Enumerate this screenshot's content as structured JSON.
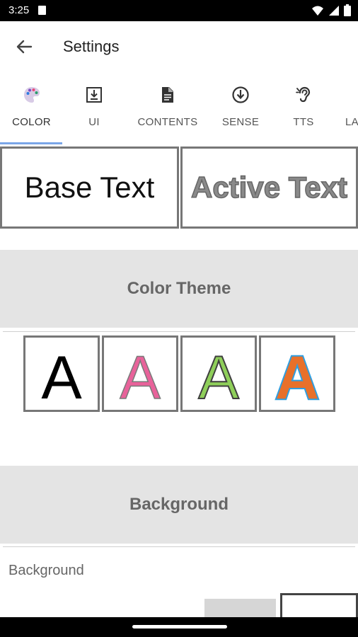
{
  "status": {
    "time": "3:25"
  },
  "header": {
    "title": "Settings"
  },
  "tabs": [
    {
      "label": "COLOR",
      "icon": "palette-icon"
    },
    {
      "label": "UI",
      "icon": "download-box-icon"
    },
    {
      "label": "CONTENTS",
      "icon": "document-icon"
    },
    {
      "label": "SENSE",
      "icon": "arrow-circle-icon"
    },
    {
      "label": "TTS",
      "icon": "ear-icon"
    },
    {
      "label": "LA",
      "icon": ""
    }
  ],
  "preview": {
    "base": "Base Text",
    "active": "Active Text"
  },
  "sections": {
    "color_theme": "Color Theme",
    "background": "Background"
  },
  "color_themes": [
    {
      "letter": "A",
      "fill": "#000000",
      "outline": ""
    },
    {
      "letter": "A",
      "fill": "#e8629a",
      "outline": "#7a7a7a"
    },
    {
      "letter": "A",
      "fill": "#8fcf5a",
      "outline": "#3f3f3f"
    },
    {
      "letter": "A",
      "fill": "#e8702a",
      "outline": "#2f9ee0"
    }
  ],
  "background": {
    "label": "Background"
  },
  "colors": {
    "accent": "#7aa6e8",
    "section_bg": "#e4e4e4"
  }
}
